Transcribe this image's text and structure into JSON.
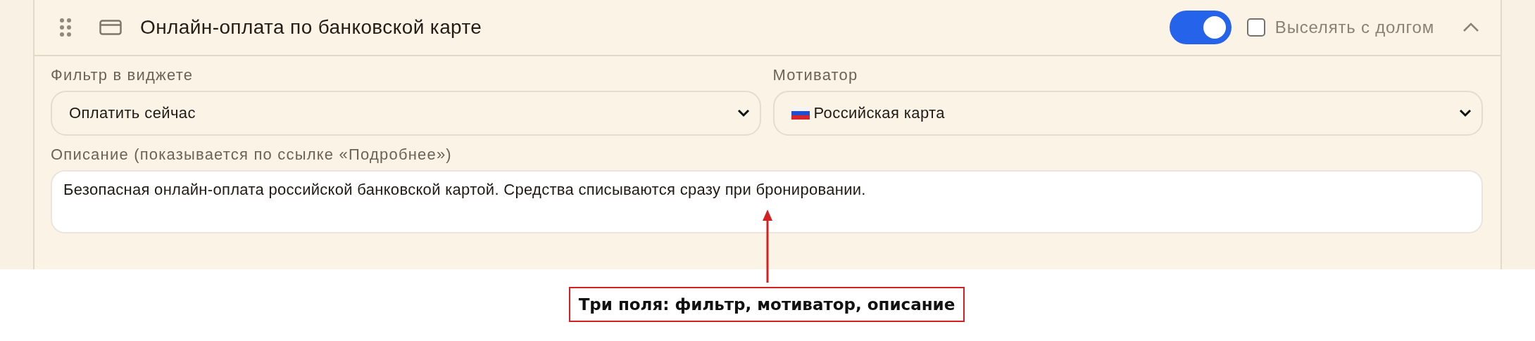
{
  "card": {
    "title": "Онлайн-оплата по банковской карте",
    "enabled": true,
    "expanded": true,
    "evict_option": {
      "label": "Выселять с долгом",
      "checked": false
    },
    "fields": [
      {
        "kind": "select",
        "label": "Фильтр в виджете",
        "value": "Оплатить сейчас"
      },
      {
        "kind": "flag_select",
        "label": "Мотиватор",
        "value": "Российская карта"
      },
      {
        "kind": "textarea",
        "label": "Описание (показывается по ссылке «Подробнее»)",
        "value": "Безопасная онлайн-оплата российской банковской картой. Средства списываются сразу при бронировании."
      }
    ]
  },
  "annotation": {
    "text": "Три поля: фильтр, мотиватор, описание"
  }
}
